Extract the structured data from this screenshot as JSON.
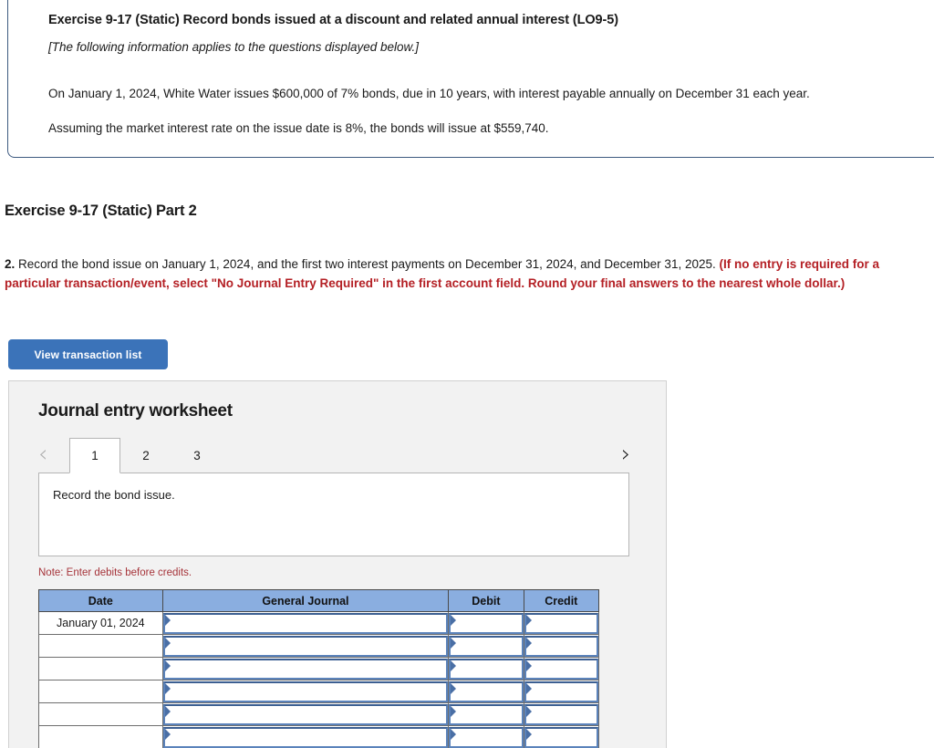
{
  "info_card": {
    "title": "Exercise 9-17 (Static) Record bonds issued at a discount and related annual interest (LO9-5)",
    "italic_note": "[The following information applies to the questions displayed below.]",
    "paragraph_1": "On January 1, 2024, White Water issues $600,000 of 7% bonds, due in 10 years, with interest payable annually on December 31 each year.",
    "paragraph_2": "Assuming the market interest rate on the issue date is 8%, the bonds will issue at $559,740."
  },
  "part": {
    "heading": "Exercise 9-17 (Static) Part 2",
    "question_number": "2.",
    "question_black": " Record the bond issue on January 1, 2024, and the first two interest payments on December 31, 2024, and December 31, 2025. ",
    "question_red": "(If no entry is required for a particular transaction/event, select \"No Journal Entry Required\" in the first account field. Round your final answers to the nearest whole dollar.)"
  },
  "toolbar": {
    "view_transaction_list_label": "View transaction list"
  },
  "worksheet": {
    "title": "Journal entry worksheet",
    "prev_icon": "chevron-left-icon",
    "next_icon": "chevron-right-icon",
    "prev_glyph": "‹",
    "next_glyph": "›",
    "tabs": [
      {
        "label": "1",
        "active": true
      },
      {
        "label": "2",
        "active": false
      },
      {
        "label": "3",
        "active": false
      }
    ],
    "description": "Record the bond issue.",
    "note": "Note: Enter debits before credits."
  },
  "journal_table": {
    "columns": [
      "Date",
      "General Journal",
      "Debit",
      "Credit"
    ],
    "rows": [
      {
        "date": "January 01, 2024",
        "general_journal": "",
        "debit": "",
        "credit": ""
      },
      {
        "date": "",
        "general_journal": "",
        "debit": "",
        "credit": ""
      },
      {
        "date": "",
        "general_journal": "",
        "debit": "",
        "credit": ""
      },
      {
        "date": "",
        "general_journal": "",
        "debit": "",
        "credit": ""
      },
      {
        "date": "",
        "general_journal": "",
        "debit": "",
        "credit": ""
      },
      {
        "date": "",
        "general_journal": "",
        "debit": "",
        "credit": ""
      }
    ]
  },
  "colors": {
    "accent_blue": "#3b73b9",
    "table_header_blue": "#8aaee0",
    "field_border_blue": "#5b83bb",
    "warning_red": "#b42025",
    "note_red": "#a6343a",
    "panel_gray": "#f2f2f2"
  }
}
